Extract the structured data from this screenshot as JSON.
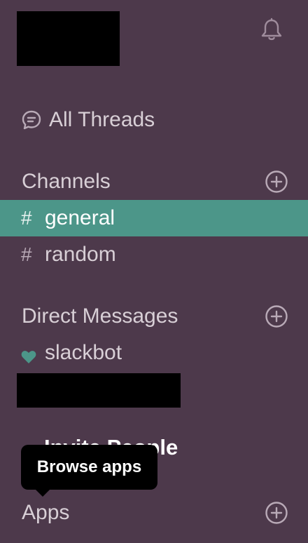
{
  "header": {
    "workspace_name_redacted": true,
    "notifications_icon": "bell-icon"
  },
  "threads": {
    "icon": "threads-icon",
    "label": "All Threads"
  },
  "channels": {
    "header": "Channels",
    "add_icon": "plus-circle-icon",
    "items": [
      {
        "prefix": "#",
        "label": "general",
        "active": true
      },
      {
        "prefix": "#",
        "label": "random",
        "active": false
      }
    ]
  },
  "direct_messages": {
    "header": "Direct Messages",
    "add_icon": "plus-circle-icon",
    "items": [
      {
        "icon": "heart-icon",
        "label": "slackbot"
      }
    ]
  },
  "invite": {
    "label": "Invite People"
  },
  "tooltip": {
    "text": "Browse apps"
  },
  "apps": {
    "header": "Apps",
    "add_icon": "plus-circle-icon"
  },
  "colors": {
    "sidebar_bg": "#4d394b",
    "active_bg": "#4c9689",
    "text": "#d8cfd6",
    "heart": "#4c9689"
  }
}
